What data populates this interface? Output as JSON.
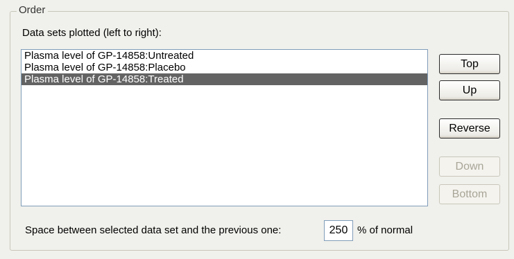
{
  "order_group": {
    "title": "Order",
    "list_label": "Data sets plotted (left to right):",
    "data_sets": [
      {
        "label": "Plasma level of GP-14858:Untreated",
        "selected": false
      },
      {
        "label": "Plasma level of GP-14858:Placebo",
        "selected": false
      },
      {
        "label": "Plasma level of GP-14858:Treated",
        "selected": true
      }
    ],
    "buttons": {
      "top": "Top",
      "up": "Up",
      "reverse": "Reverse",
      "down": "Down",
      "bottom": "Bottom"
    },
    "spacing": {
      "label": "Space between selected data set and the previous one:",
      "value": "250",
      "unit": "% of normal"
    }
  },
  "colors": {
    "selection_background": "#636363",
    "disabled_text": "#a8a597",
    "dialog_background": "#f0f0ec"
  }
}
